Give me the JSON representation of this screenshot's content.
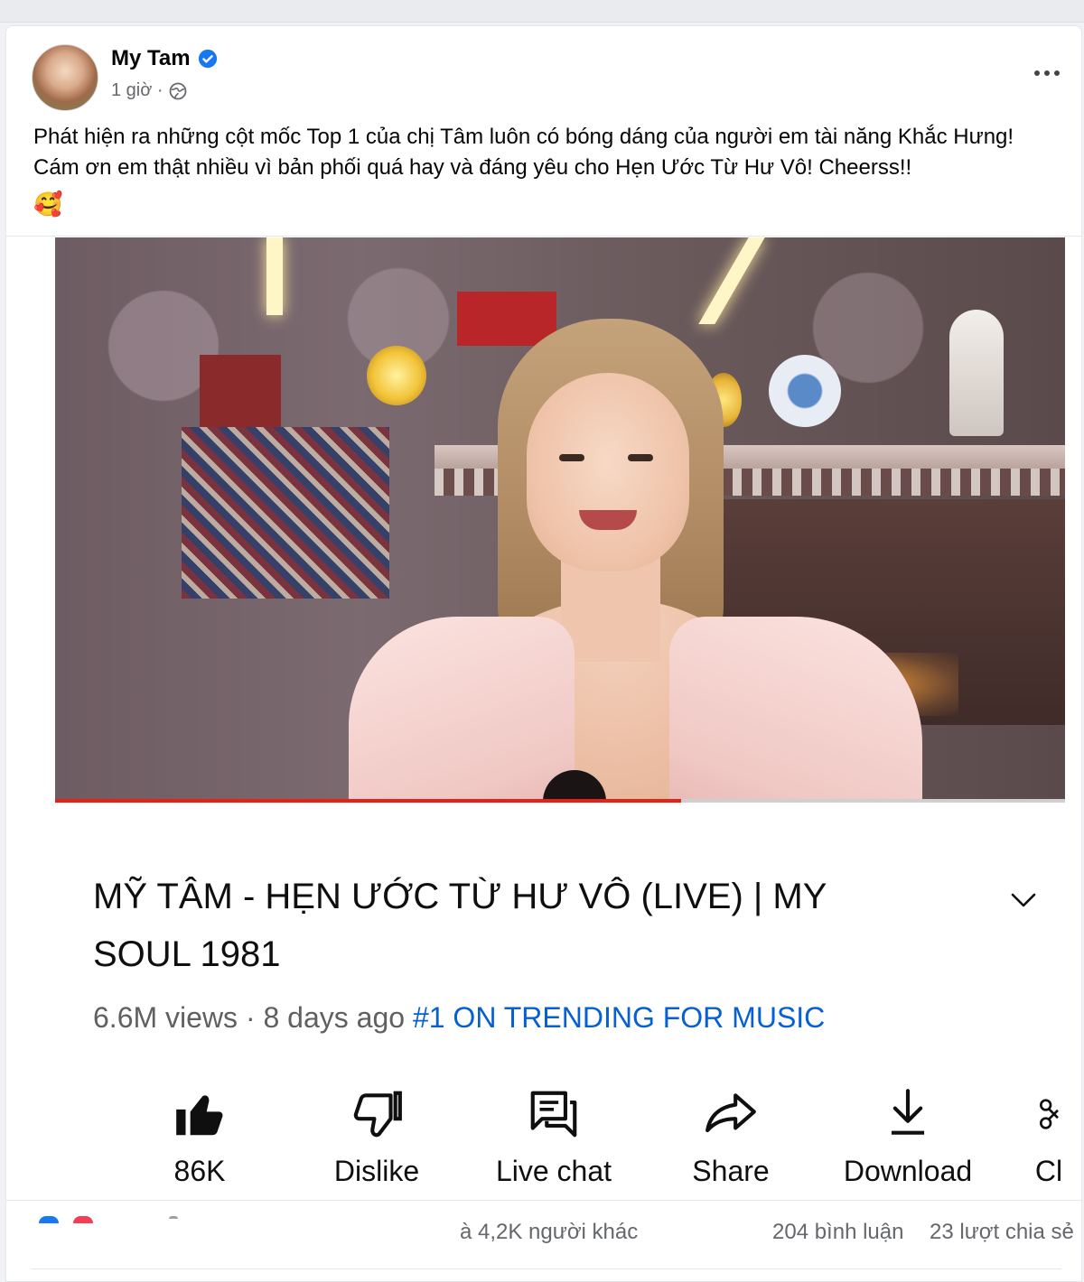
{
  "post": {
    "author": "My Tam",
    "time": "1 giờ ·",
    "text": "Phát hiện ra những cột mốc Top 1 của chị Tâm luôn có bóng dáng của người em tài năng Khắc Hưng! Cám ơn em thật nhiều vì bản phối quá hay và đáng yêu cho Hẹn Ước Từ Hư Vô! Cheerss!!",
    "emoji": "🥰",
    "verified_color": "#1877f2"
  },
  "video": {
    "progress_fraction": 0.62,
    "progress_color": "#e62117",
    "title": "MỸ TÂM - HẸN ƯỚC TỪ HƯ VÔ (LIVE) | MY SOUL 1981",
    "views": "6.6M views · 8 days ago",
    "trending": "#1 ON TRENDING FOR MUSIC",
    "trending_color": "#065fd4"
  },
  "actions": [
    {
      "icon": "thumbs-up-filled-icon",
      "label": "86K"
    },
    {
      "icon": "thumbs-down-icon",
      "label": "Dislike"
    },
    {
      "icon": "live-chat-icon",
      "label": "Live chat"
    },
    {
      "icon": "share-arrow-icon",
      "label": "Share"
    },
    {
      "icon": "download-icon",
      "label": "Download"
    },
    {
      "icon": "clip-scissors-icon",
      "label": "Cl"
    }
  ],
  "footer": {
    "reactions_text": "à 4,2K người khác",
    "comments": "204 bình luận",
    "shares": "23 lượt chia sẻ"
  }
}
